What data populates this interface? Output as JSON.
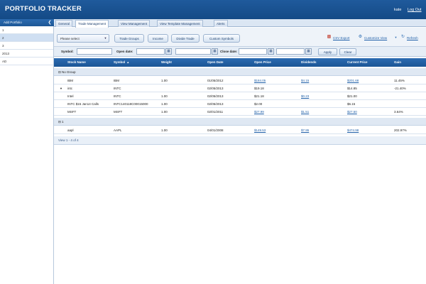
{
  "header": {
    "title": "PORTFOLIO TRACKER",
    "user": "kate",
    "logout": "Log Out"
  },
  "sidebar": {
    "add_button": "Add Portfolio",
    "items": [
      {
        "label": "1"
      },
      {
        "label": "2"
      },
      {
        "label": "3"
      },
      {
        "label": "2013"
      },
      {
        "label": "AD"
      }
    ],
    "selected_index": 1
  },
  "tabs": [
    {
      "label": "General"
    },
    {
      "label": "Trade Management"
    },
    {
      "label": "View Management"
    },
    {
      "label": "View Template Management"
    },
    {
      "label": "Alerts"
    }
  ],
  "active_tab": "Trade Management",
  "toolbar": {
    "select_value": "Please select",
    "trade_groups": "Trade Groups",
    "income": "Income",
    "divide_trade": "Divide Trade",
    "custom_symbols": "Custom Symbols",
    "csv_export": "CSV Export",
    "customize_view": "Customize View",
    "refresh": "Refresh"
  },
  "filters": {
    "symbol_label": "Symbol:",
    "open_date_label": "Open date:",
    "close_date_label": "Close date:",
    "apply": "Apply",
    "clear": "Clear"
  },
  "table": {
    "columns": [
      "Stock Name",
      "Symbol",
      "Weight",
      "Open Date",
      "Open Price",
      "Dividends",
      "Current Price",
      "Gain"
    ],
    "groups": [
      {
        "label": "No Group",
        "rows": [
          {
            "name": "IBM",
            "symbol": "IBM",
            "weight": "1.00",
            "open_date": "01/05/2012",
            "open_price": "$184.05",
            "dividends": "$4.15",
            "current_price": "$201.68",
            "gain": "11.45%"
          },
          {
            "name": "intc",
            "symbol": "INTC",
            "weight": "",
            "open_date": "02/05/2013",
            "open_price": "$19.18",
            "dividends": "",
            "current_price": "$14.85",
            "gain": "-21.40%",
            "expanded": true
          },
          {
            "name": "Intel",
            "symbol": "INTC",
            "weight": "1.00",
            "open_date": "02/05/2013",
            "open_price": "$21.18",
            "dividends": "$0.23",
            "current_price": "$21.00",
            "gain": ""
          },
          {
            "name": "INTC $15 Jan14 Calls",
            "symbol": "INTC140118C00015000",
            "weight": "1.00",
            "open_date": "02/05/2013",
            "open_price": "$2.00",
            "dividends": "",
            "current_price": "$6.15",
            "gain": ""
          },
          {
            "name": "MSFT",
            "symbol": "MSFT",
            "weight": "1.00",
            "open_date": "02/01/2011",
            "open_price": "$27.99",
            "dividends": "$1.51",
            "current_price": "$27.50",
            "gain": "3.64%"
          }
        ]
      },
      {
        "label": "1",
        "rows": [
          {
            "name": "aapl",
            "symbol": "AAPL",
            "weight": "1.00",
            "open_date": "04/01/2008",
            "open_price": "$149.53",
            "dividends": "$7.95",
            "current_price": "$474.98",
            "gain": "202.97%"
          }
        ]
      }
    ],
    "footer": "View 1 - 4 of 4"
  }
}
